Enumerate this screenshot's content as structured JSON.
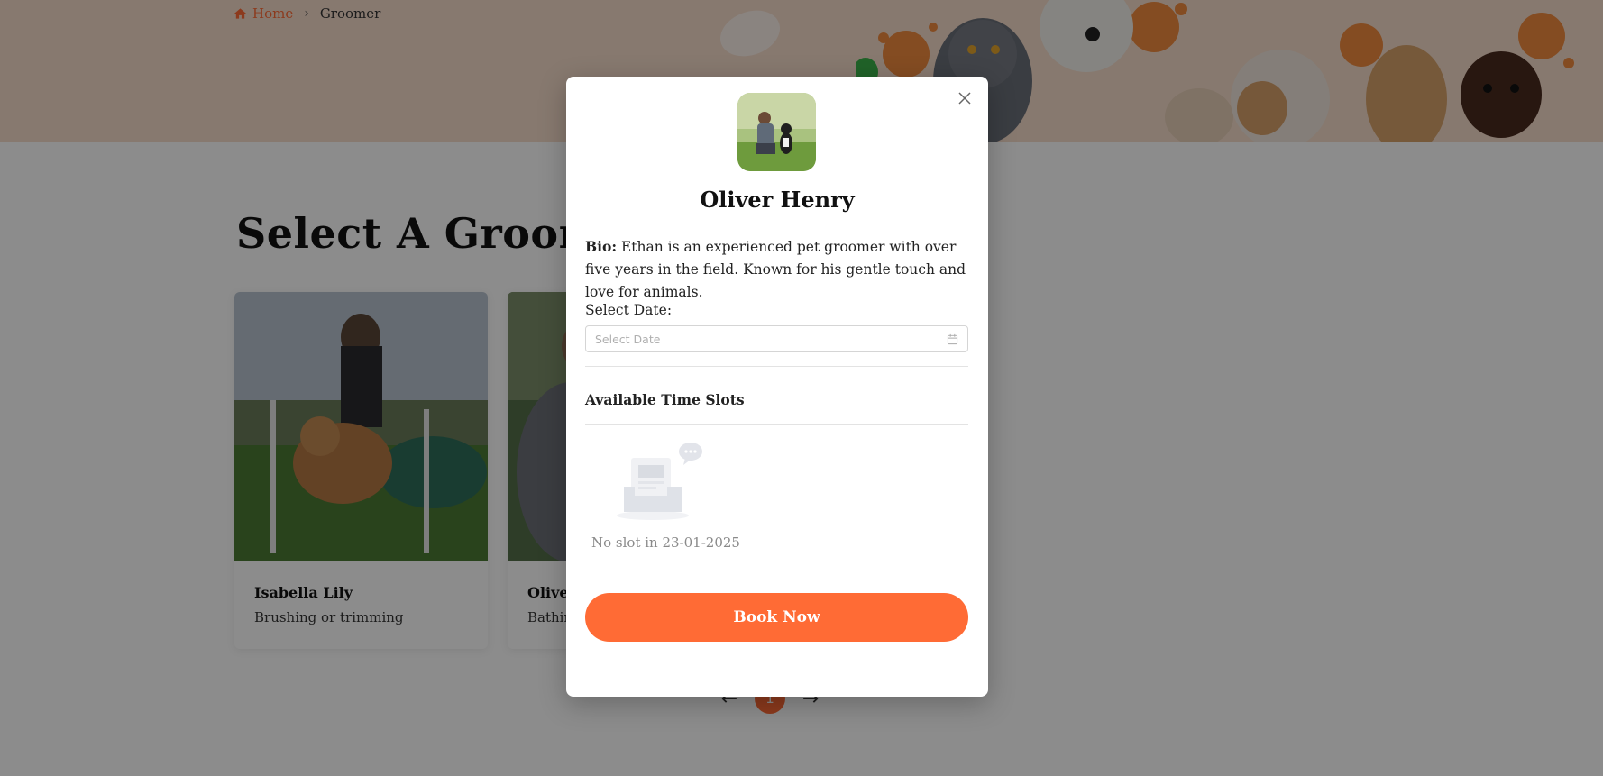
{
  "breadcrumb": {
    "home": "Home",
    "current": "Groomer"
  },
  "section": {
    "title": "Select A Groomer"
  },
  "cards": [
    {
      "name": "Isabella Lily",
      "service": "Brushing or trimming"
    },
    {
      "name": "Oliver Henry",
      "service": "Bathing"
    }
  ],
  "pagination": {
    "current_page": "1",
    "prev_icon": "arrow-left-icon",
    "next_icon": "arrow-right-icon"
  },
  "modal": {
    "name": "Oliver Henry",
    "bio_label": "Bio:",
    "bio_text": " Ethan is an experienced pet groomer with over five years in the field. Known for his gentle touch and love for animals.",
    "date_label": "Select Date:",
    "date_placeholder": "Select Date",
    "slots_title": "Available Time Slots",
    "empty_text": "No slot in 23-01-2025",
    "book_label": "Book Now"
  },
  "colors": {
    "accent": "#ff6b35",
    "hero_bg": "#f6dccb",
    "overlay": "rgba(0,0,0,0.45)"
  }
}
